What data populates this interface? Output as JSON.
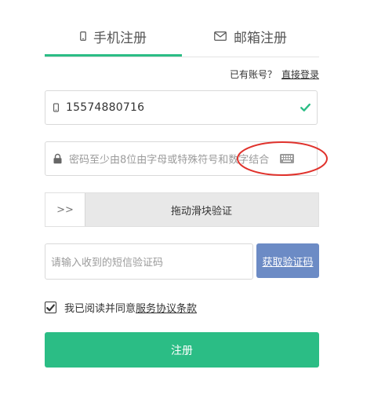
{
  "tabs": {
    "phone_label": "手机注册",
    "email_label": "邮箱注册",
    "active": "phone",
    "phone_icon": "mobile-phone-icon",
    "email_icon": "envelope-icon"
  },
  "login": {
    "prompt": "已有账号？",
    "link_label": "直接登录"
  },
  "phone_field": {
    "value": "15574880716",
    "icon": "mobile-phone-icon",
    "status_icon": "check-icon"
  },
  "password_field": {
    "placeholder": "密码至少由8位由字母或特殊符号和数字结合",
    "icon": "lock-icon",
    "keyboard_icon": "keyboard-icon"
  },
  "slider": {
    "handle_label": ">>",
    "label": "拖动滑块验证"
  },
  "sms": {
    "placeholder": "请输入收到的短信验证码",
    "button_label": "获取验证码"
  },
  "agreement": {
    "checked": true,
    "text": "我已阅读并同意",
    "link_label": "服务协议条款"
  },
  "register_button": {
    "label": "注册"
  },
  "colors": {
    "accent": "#2bbd85",
    "sms_button": "#6c8bc5",
    "annotation": "#e0322c"
  }
}
